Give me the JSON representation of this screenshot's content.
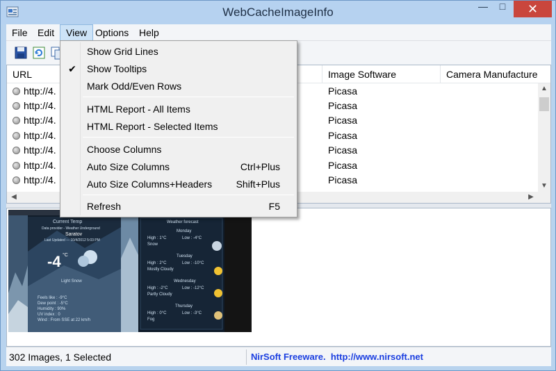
{
  "window": {
    "title": "WebCacheImageInfo",
    "close_glyph": "✕",
    "min_glyph": "—",
    "max_glyph": "□"
  },
  "menu": {
    "items": [
      "File",
      "Edit",
      "View",
      "Options",
      "Help"
    ]
  },
  "toolbar": {
    "icons": [
      "save-icon",
      "refresh-icon",
      "copy-icon"
    ]
  },
  "list": {
    "columns": [
      "URL",
      "Image Software",
      "Camera Manufacturer"
    ],
    "rows": [
      {
        "url": "http://4.",
        "software": "Picasa"
      },
      {
        "url": "http://4.",
        "software": "Picasa"
      },
      {
        "url": "http://4.",
        "software": "Picasa"
      },
      {
        "url": "http://4.",
        "software": "Picasa"
      },
      {
        "url": "http://4.",
        "software": "Picasa"
      },
      {
        "url": "http://4.",
        "software": "Picasa"
      },
      {
        "url": "http://4.",
        "software": "Picasa"
      }
    ]
  },
  "view_menu": {
    "items": [
      {
        "label": "Show Grid Lines",
        "shortcut": "",
        "checked": false
      },
      {
        "label": "Show Tooltips",
        "shortcut": "",
        "checked": true
      },
      {
        "label": "Mark Odd/Even Rows",
        "shortcut": "",
        "checked": false
      },
      {
        "label": "HTML Report - All Items",
        "shortcut": "",
        "checked": false
      },
      {
        "label": "HTML Report - Selected Items",
        "shortcut": "",
        "checked": false
      },
      {
        "label": "Choose Columns",
        "shortcut": "",
        "checked": false
      },
      {
        "label": "Auto Size Columns",
        "shortcut": "Ctrl+Plus",
        "checked": false
      },
      {
        "label": "Auto Size Columns+Headers",
        "shortcut": "Shift+Plus",
        "checked": false
      },
      {
        "label": "Refresh",
        "shortcut": "F5",
        "checked": false
      }
    ],
    "check_glyph": "✔"
  },
  "preview": {
    "current": {
      "heading": "Current Temp",
      "provider": "Data provider - Weather Underground",
      "city": "Saratov",
      "updated": "Last Updated — 10/4/2012 5:03 PM",
      "temp": "-4",
      "unit": "°C",
      "condition": "Light Snow",
      "details": [
        "Feels like : -9°C",
        "Dew point : -5°C",
        "Humidity : 90%",
        "UV index : 0",
        "Wind : From SSE at 22 km/h"
      ]
    },
    "forecast": {
      "heading": "Weather forecast",
      "days": [
        {
          "day": "Monday",
          "high": "High : 1°C",
          "low": "Low : -4°C",
          "cond": "Snow"
        },
        {
          "day": "Tuesday",
          "high": "High : 2°C",
          "low": "Low : -10°C",
          "cond": "Mostly Cloudy"
        },
        {
          "day": "Wednesday",
          "high": "High : -2°C",
          "low": "Low : -12°C",
          "cond": "Partly Cloudy"
        },
        {
          "day": "Thursday",
          "high": "High : 0°C",
          "low": "Low : -3°C",
          "cond": "Fog"
        }
      ]
    }
  },
  "status": {
    "left": "302 Images, 1 Selected",
    "right": "NirSoft Freeware.  http://www.nirsoft.net"
  },
  "colors": {
    "accent": "#1a3ee0",
    "close": "#c9463d",
    "titlebar": "#b6d2f0"
  }
}
